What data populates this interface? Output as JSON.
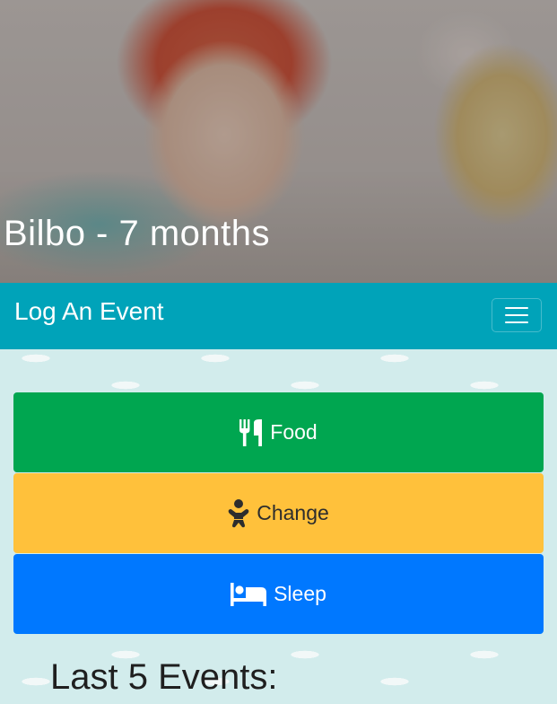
{
  "hero": {
    "title": "Bilbo - 7 months"
  },
  "navbar": {
    "brand": "Log An Event",
    "toggler_icon": "hamburger-icon"
  },
  "actions": [
    {
      "label": "Food",
      "icon": "utensils-icon",
      "color": "#00a650"
    },
    {
      "label": "Change",
      "icon": "baby-icon",
      "color": "#ffc13b"
    },
    {
      "label": "Sleep",
      "icon": "bed-icon",
      "color": "#0078ff"
    }
  ],
  "events": {
    "title": "Last 5 Events:"
  },
  "colors": {
    "navbar": "#00a3b9",
    "background": "#d2ecec"
  }
}
